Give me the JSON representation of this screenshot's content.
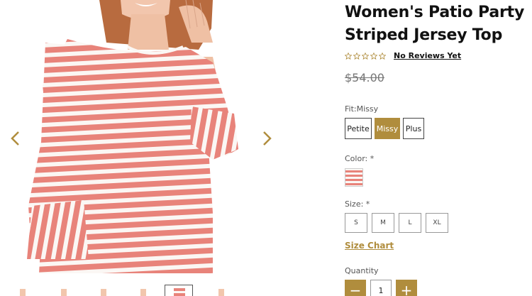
{
  "product": {
    "title": "Women's Patio Party Striped Jersey Top",
    "rating_stars": 0,
    "reviews_label": "No Reviews Yet",
    "price": "$54.00"
  },
  "options": {
    "fit_label": "Fit:Missy",
    "fit_values": [
      "Petite",
      "Missy",
      "Plus"
    ],
    "fit_selected": "Missy",
    "color_label": "Color:",
    "size_label": "Size:",
    "required_mark": "*",
    "sizes": [
      "S",
      "M",
      "L",
      "XL"
    ],
    "size_chart_label": "Size Chart",
    "quantity_label": "Quantity",
    "quantity_value": "1",
    "minus_label": "−",
    "plus_label": "+"
  },
  "colors": {
    "accent": "#b08d3d",
    "stripe": "#e8837a"
  },
  "icons": {
    "prev": "chevron-left-icon",
    "next": "chevron-right-icon",
    "star": "star-outline-icon"
  }
}
